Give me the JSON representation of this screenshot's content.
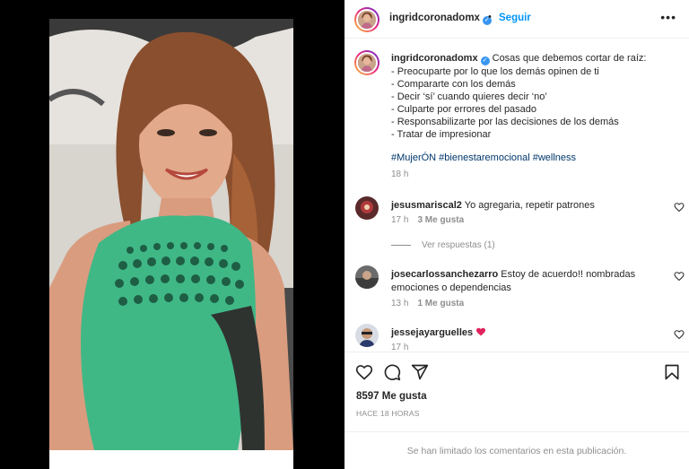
{
  "post": {
    "username": "ingridcoronadomx",
    "verified_mark": "✓",
    "separator": "•",
    "follow_label": "Seguir",
    "more_label": "•••"
  },
  "caption": {
    "username": "ingridcoronadomx",
    "lines": [
      "Cosas que debemos cortar de raíz:",
      "- Preocuparte por lo que los demás opinen de ti",
      "- Compararte con los demás",
      "- Decir ‘sí’ cuando quieres decir ‘no’",
      "- Culparte por errores del pasado",
      "- Responsabilizarte por las decisiones de los demás",
      "- Tratar de impresionar"
    ],
    "hashtags": "#MujerÓN #bienestaremocional #wellness",
    "time": "18 h"
  },
  "comments": [
    {
      "username": "jesusmariscal2",
      "text": "Yo agregaria, repetir patrones",
      "time": "17 h",
      "likes": "3 Me gusta",
      "replies": "Ver respuestas (1)"
    },
    {
      "username": "josecarlossanchezarro",
      "text": "Estoy de acuerdo!! nombradas emociones o dependencias",
      "time": "13 h",
      "likes": "1 Me gusta"
    },
    {
      "username": "jessejayarguelles",
      "text": "",
      "time": "17 h"
    }
  ],
  "actions": {
    "likes_count": "8597 Me gusta",
    "posted": "HACE 18 HORAS"
  },
  "comments_limited": "Se han limitado los comentarios en esta publicación.",
  "icons": {
    "like": "heart-icon",
    "comment": "comment-icon",
    "share": "paper-plane-icon",
    "save": "bookmark-icon",
    "more": "more-horizontal-icon"
  },
  "colors": {
    "link_blue": "#0095f6",
    "hashtag": "#00376b",
    "muted": "#8e8e8e",
    "dress_green": "#3fb886",
    "heart_red": "#ed4956"
  }
}
